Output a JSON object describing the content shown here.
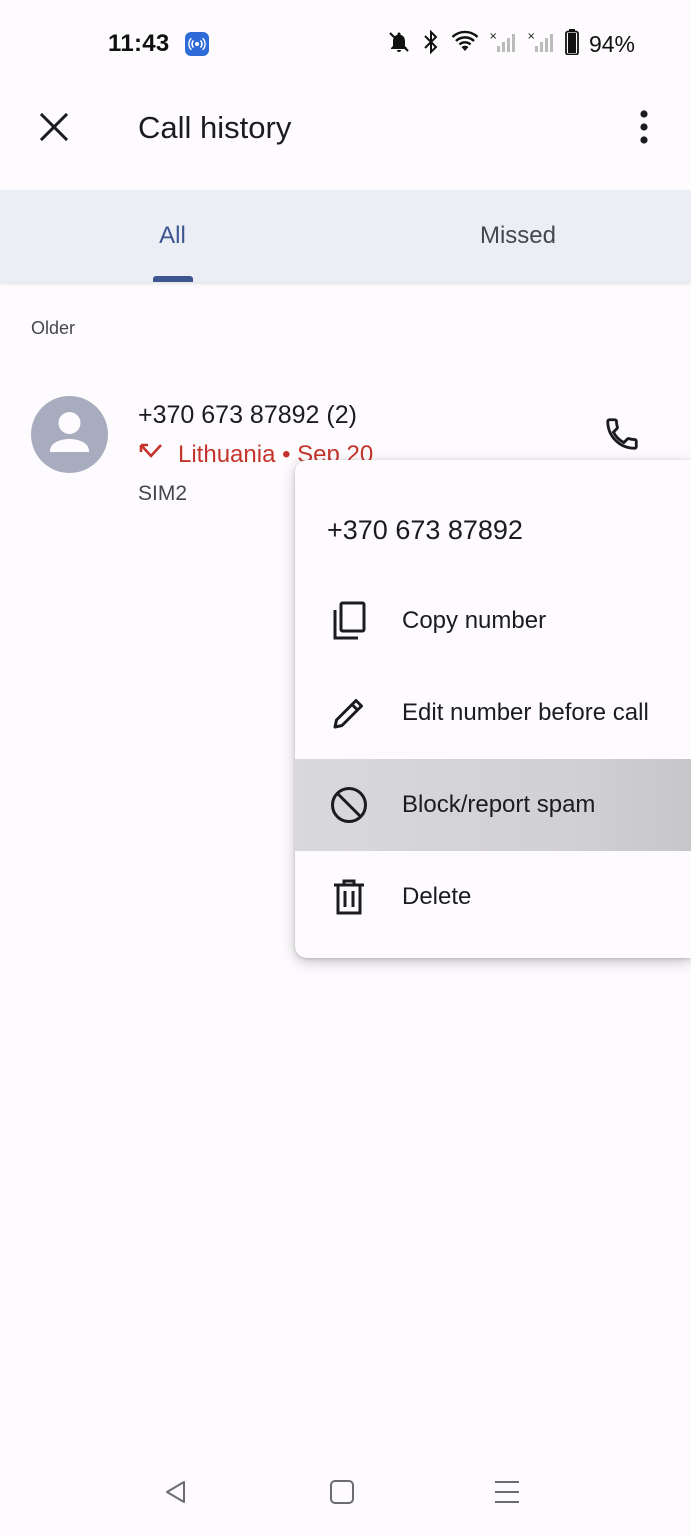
{
  "status_bar": {
    "time": "11:43",
    "battery_percent": "94%",
    "icons": [
      "cast-icon",
      "bell-off-icon",
      "bluetooth-icon",
      "wifi-icon",
      "signal-sim1-icon",
      "signal-sim2-icon",
      "battery-icon"
    ]
  },
  "app_bar": {
    "title": "Call history",
    "close_icon": "close-icon",
    "more_icon": "more-vert-icon"
  },
  "tabs": [
    {
      "label": "All",
      "selected": true
    },
    {
      "label": "Missed",
      "selected": false
    }
  ],
  "section": {
    "label": "Older"
  },
  "call_entry": {
    "number": "+370 673 87892  (2)",
    "detail": "Lithuania • Sep 20",
    "sim": "SIM2",
    "detail_color": "#c5342c",
    "call_type_icon": "missed-call-icon"
  },
  "menu": {
    "title": "+370 673 87892",
    "items": [
      {
        "label": "Copy number",
        "icon": "copy-icon"
      },
      {
        "label": "Edit number before call",
        "icon": "pencil-icon"
      },
      {
        "label": "Block/report spam",
        "icon": "block-icon",
        "highlighted": true
      },
      {
        "label": "Delete",
        "icon": "trash-icon"
      }
    ]
  },
  "nav_bar": {
    "buttons": [
      "back-icon",
      "home-icon",
      "recents-icon"
    ]
  },
  "colors": {
    "accent": "#3d568f",
    "tab_bar_bg": "#eceef5",
    "missed_red": "#c5342c",
    "avatar_bg": "#a7acbe"
  }
}
